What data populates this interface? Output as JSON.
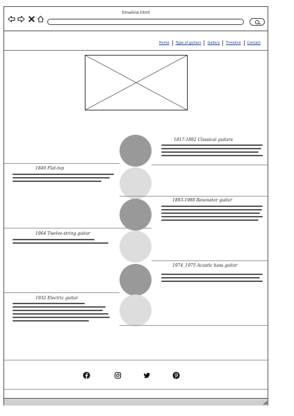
{
  "browser": {
    "tab_title": "timeline.html",
    "nav_icons": [
      "arrow-left-icon",
      "arrow-right-icon",
      "close-icon",
      "home-icon"
    ],
    "address": "",
    "search_icon": "search-icon"
  },
  "nav": {
    "links": [
      "Home",
      "Type of guitars",
      "Gallery",
      "Timeline",
      "Contact"
    ],
    "link_color": "#1e3f9e"
  },
  "hero": {
    "type": "image-placeholder"
  },
  "timeline": {
    "dark_color": "#999999",
    "light_color": "#dddddd",
    "entries": [
      {
        "title": "1817-1892 Classical guitars",
        "side": "right",
        "tone": "dark"
      },
      {
        "title": "1840 Flat-top",
        "side": "left",
        "tone": "light"
      },
      {
        "title": "1893-1988 Resonator guitar",
        "side": "right",
        "tone": "dark"
      },
      {
        "title": "1964 Twelve-string guitar",
        "side": "left",
        "tone": "light"
      },
      {
        "title": "1974_1975 Acustic bass guitar",
        "side": "right",
        "tone": "dark"
      },
      {
        "title": "1932 Electric guitar",
        "side": "left",
        "tone": "light"
      }
    ]
  },
  "footer": {
    "social": [
      "facebook-icon",
      "instagram-icon",
      "twitter-icon",
      "pinterest-icon"
    ]
  }
}
